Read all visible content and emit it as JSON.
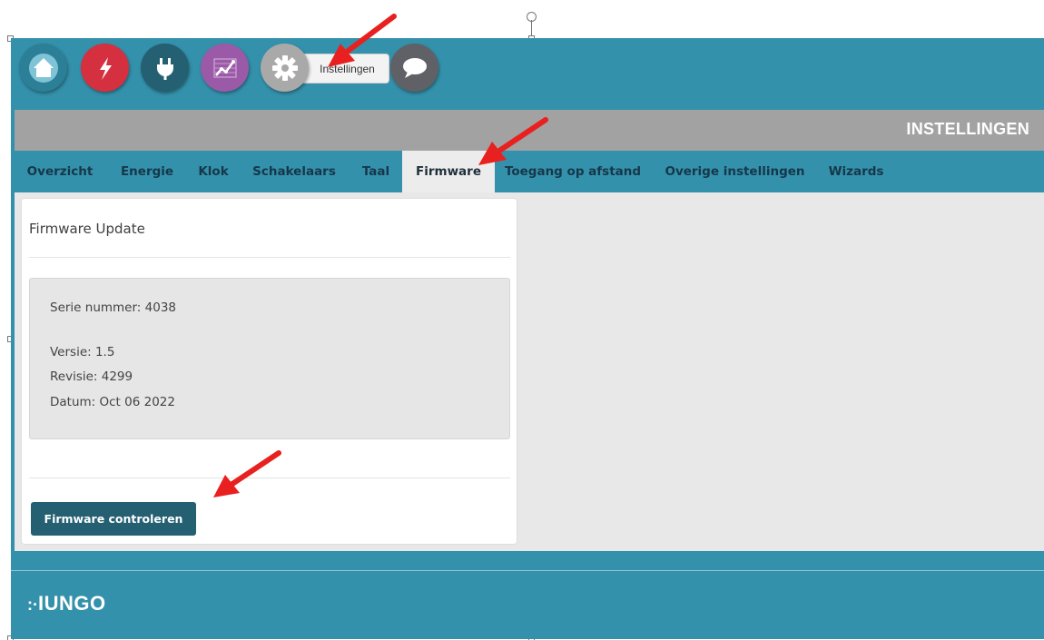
{
  "topbar": {
    "icons": [
      "home-icon",
      "lightning-icon",
      "plug-icon",
      "graph-icon",
      "gear-icon",
      "chat-icon"
    ],
    "tooltip": "Instellingen"
  },
  "header": {
    "title": "INSTELLINGEN"
  },
  "tabs": [
    {
      "label": "Overzicht",
      "active": false
    },
    {
      "label": "Energie",
      "active": false
    },
    {
      "label": "Klok",
      "active": false
    },
    {
      "label": "Schakelaars",
      "active": false
    },
    {
      "label": "Taal",
      "active": false
    },
    {
      "label": "Firmware",
      "active": true
    },
    {
      "label": "Toegang op afstand",
      "active": false
    },
    {
      "label": "Overige instellingen",
      "active": false
    },
    {
      "label": "Wizards",
      "active": false
    }
  ],
  "card": {
    "title": "Firmware Update",
    "serial": "Serie nummer: 4038",
    "version": "Versie: 1.5",
    "revision": "Revisie: 4299",
    "date": "Datum: Oct 06 2022",
    "button": "Firmware controleren"
  },
  "footer": {
    "logo": "IUNGO"
  },
  "colors": {
    "brand": "#3491ab",
    "dark_button": "#245f72",
    "energy_red": "#d53040",
    "graph_purple": "#9b5aa8",
    "annotation_arrow": "#e8201f"
  }
}
